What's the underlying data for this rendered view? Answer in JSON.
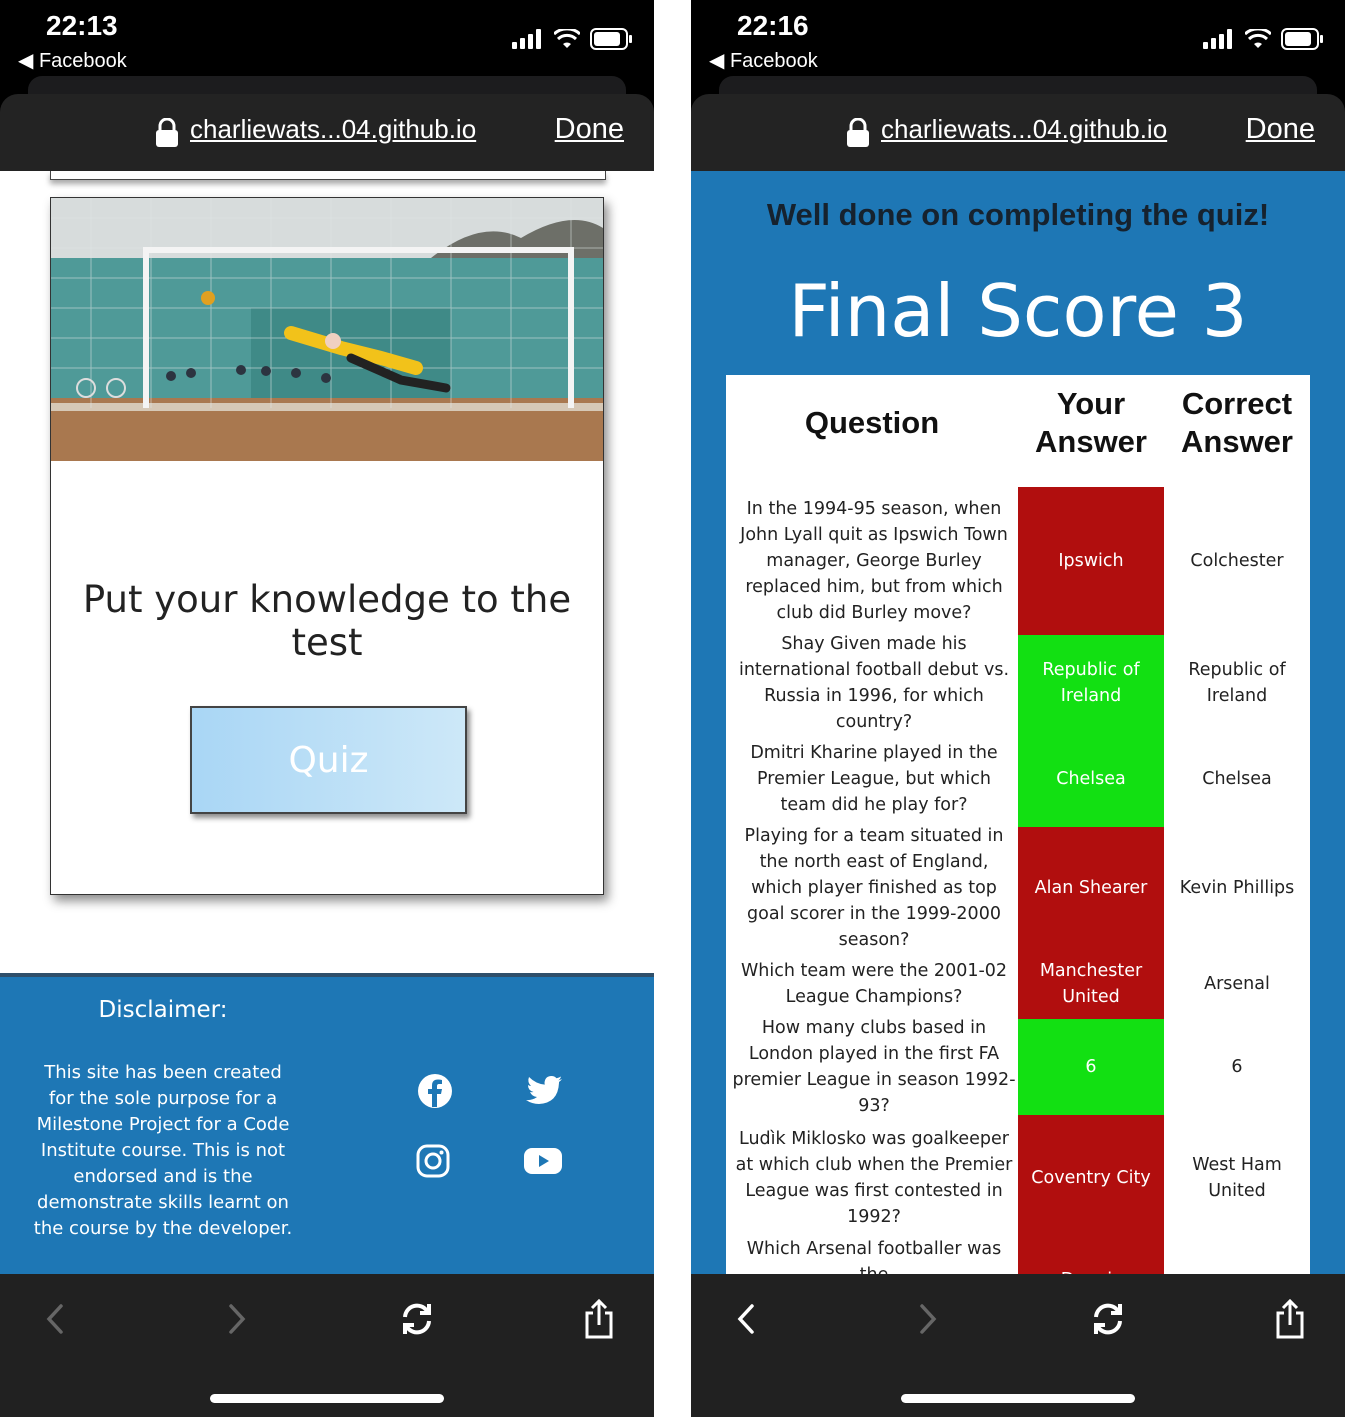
{
  "left": {
    "status": {
      "time": "22:13",
      "back_label": "Facebook"
    },
    "urlbar": {
      "url": "charliewats...04.github.io",
      "done_label": "Done"
    },
    "hero_alt": "",
    "tagline": "Put your knowledge to the test",
    "quiz_button": "Quiz",
    "footer": {
      "disclaimer_title": "Disclaimer:",
      "disclaimer_text": "This site has been created for the sole purpose for a Milestone Project for a Code Institute course. This is not endorsed and is the demonstrate skills learnt on the course by the developer.",
      "social": [
        "facebook-icon",
        "twitter-icon",
        "instagram-icon",
        "youtube-icon"
      ]
    },
    "toolbar": [
      "back-icon",
      "forward-icon",
      "reload-icon",
      "share-icon"
    ]
  },
  "right": {
    "status": {
      "time": "22:16",
      "back_label": "Facebook"
    },
    "urlbar": {
      "url": "charliewats...04.github.io",
      "done_label": "Done"
    },
    "congrats": "Well done on completing the quiz!",
    "final_score": "Final Score 3",
    "table": {
      "headers": {
        "question": "Question",
        "your_answer": "Your Answer",
        "correct_answer": "Correct Answer"
      },
      "rows": [
        {
          "question": "In the 1994-95 season, when John Lyall quit as Ipswich Town manager, George Burley replaced him, but from which club did Burley move?",
          "your_answer": "Ipswich",
          "correct_answer": "Colchester",
          "correct": false
        },
        {
          "question": "Shay Given made his international football debut vs. Russia in 1996, for which country?",
          "your_answer": "Republic of Ireland",
          "correct_answer": "Republic of Ireland",
          "correct": true
        },
        {
          "question": "Dmitri Kharine played in the Premier League, but which team did he play for?",
          "your_answer": "Chelsea",
          "correct_answer": "Chelsea",
          "correct": true
        },
        {
          "question": "Playing for a team situated in the north east of England, which player finished as top goal scorer in the 1999-2000 season?",
          "your_answer": "Alan Shearer",
          "correct_answer": "Kevin Phillips",
          "correct": false
        },
        {
          "question": "Which team were the 2001-02 League Champions?",
          "your_answer": "Manchester United",
          "correct_answer": "Arsenal",
          "correct": false
        },
        {
          "question": "How many clubs based in London played in the first FA premier League in season 1992-93?",
          "your_answer": "6",
          "correct_answer": "6",
          "correct": true
        },
        {
          "question": "Ludìk Miklosko was goalkeeper at which club when the Premier League was first contested in 1992?",
          "your_answer": "Coventry City",
          "correct_answer": "West Ham United",
          "correct": false
        },
        {
          "question": "Which Arsenal footballer was the",
          "your_answer": "Dennis",
          "correct_answer": "",
          "correct": false
        }
      ]
    },
    "colors": {
      "wrong": "#b10e0e",
      "right": "#12e012",
      "page_bg": "#1e77b5"
    }
  }
}
